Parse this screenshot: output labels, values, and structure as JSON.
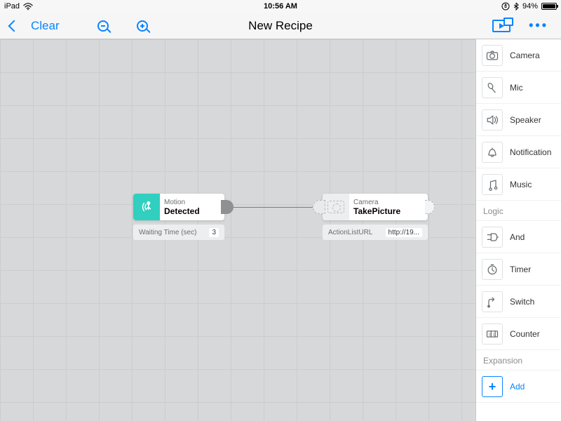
{
  "statusbar": {
    "device": "iPad",
    "time": "10:56 AM",
    "battery_pct": "94%"
  },
  "navbar": {
    "clear": "Clear",
    "title": "New Recipe"
  },
  "palette": {
    "camera": "Camera",
    "mic": "Mic",
    "speaker": "Speaker",
    "notification": "Notification",
    "music": "Music",
    "logic_header": "Logic",
    "and": "And",
    "timer": "Timer",
    "switch": "Switch",
    "counter": "Counter",
    "expansion_header": "Expansion",
    "add": "Add"
  },
  "nodes": {
    "motion": {
      "cat": "Motion",
      "name": "Detected",
      "param_label": "Waiting Time (sec)",
      "param_value": "3"
    },
    "camera": {
      "cat": "Camera",
      "name": "TakePicture",
      "param_label": "ActionListURL",
      "param_value": "http://19..."
    }
  }
}
